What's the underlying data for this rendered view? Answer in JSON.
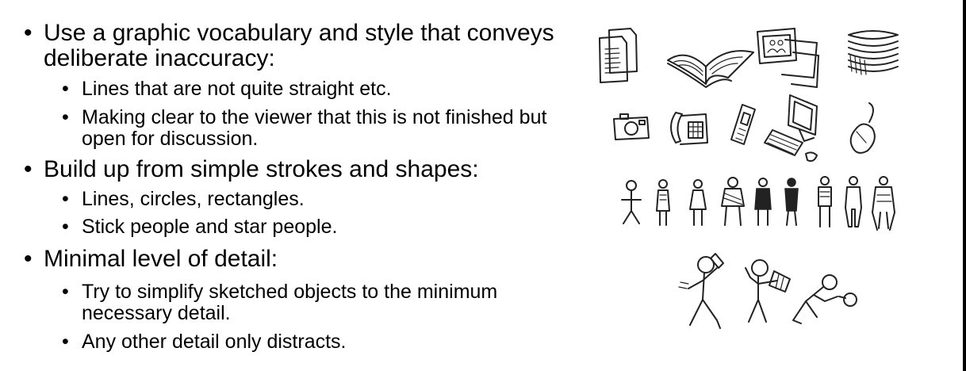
{
  "bullets": [
    {
      "text": "Use a graphic vocabulary and style that conveys deliberate inaccuracy:",
      "subs": [
        "Lines that are not quite straight etc.",
        "Making clear to the viewer that this is not finished but open for discussion."
      ]
    },
    {
      "text": "Build up from simple strokes and shapes:",
      "subs": [
        "Lines, circles, rectangles.",
        "Stick people and star people."
      ]
    },
    {
      "text": "Minimal level of detail:",
      "subs": [
        "Try to simplify sketched objects to the minimum necessary detail.",
        "Any other detail only distracts."
      ]
    }
  ],
  "sketch_icons": {
    "row1": [
      "document-stack-icon",
      "open-book-icon",
      "photo-prints-icon",
      "paper-stack-icon"
    ],
    "row2": [
      "camera-icon",
      "desk-phone-icon",
      "mobile-phone-icon",
      "desktop-computer-icon",
      "computer-mouse-icon"
    ],
    "row3": [
      "stick-figure-icon",
      "dressed-figure-icon",
      "skirt-figure-icon",
      "hatched-figure-icon",
      "shaded-figure-icon",
      "dark-figure-icon",
      "trousers-figure-icon",
      "outline-figure-icon",
      "coat-figure-icon"
    ],
    "row4": [
      "figure-on-phone-icon",
      "figure-reading-map-icon",
      "figure-with-magnifier-icon"
    ]
  }
}
